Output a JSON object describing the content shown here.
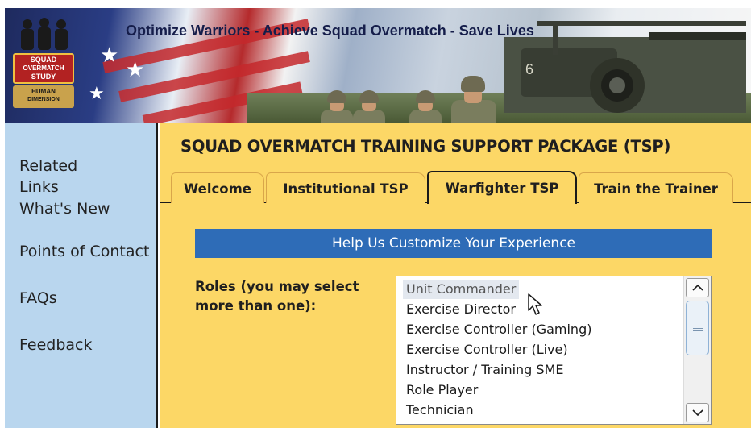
{
  "header": {
    "tagline": "Optimize Warriors - Achieve Squad Overmatch - Save Lives",
    "logo": {
      "line1": "SQUAD",
      "line2": "OVERMATCH",
      "line3": "STUDY",
      "line4": "HUMAN",
      "line5": "DIMENSION"
    }
  },
  "sidebar": {
    "items": [
      {
        "label": "Related"
      },
      {
        "label": "Links"
      },
      {
        "label": "What's New"
      },
      {
        "label": "Points of Contact"
      },
      {
        "label": "FAQs"
      },
      {
        "label": "Feedback"
      }
    ]
  },
  "main": {
    "title": "SQUAD OVERMATCH TRAINING SUPPORT PACKAGE (TSP)",
    "tabs": [
      {
        "label": "Welcome"
      },
      {
        "label": "Institutional TSP"
      },
      {
        "label": "Warfighter TSP"
      },
      {
        "label": "Train the Trainer"
      }
    ],
    "active_tab": "Warfighter TSP",
    "customize_banner": "Help Us Customize Your Experience",
    "roles_label": "Roles (you may select more than one):",
    "roles_options": [
      {
        "label": "Unit Commander"
      },
      {
        "label": "Exercise Director"
      },
      {
        "label": "Exercise Controller (Gaming)"
      },
      {
        "label": "Exercise Controller (Live)"
      },
      {
        "label": "Instructor / Training SME"
      },
      {
        "label": "Role Player"
      },
      {
        "label": "Technician"
      }
    ]
  },
  "colors": {
    "sidebar_bg": "#b9d6ee",
    "main_bg": "#fcd766",
    "banner_blue": "#2e6cb7",
    "title_navy": "#151d4a"
  },
  "icons": {
    "scroll_up": "chevron-up-icon",
    "scroll_down": "chevron-down-icon",
    "mouse_cursor": "arrow-cursor-icon"
  }
}
